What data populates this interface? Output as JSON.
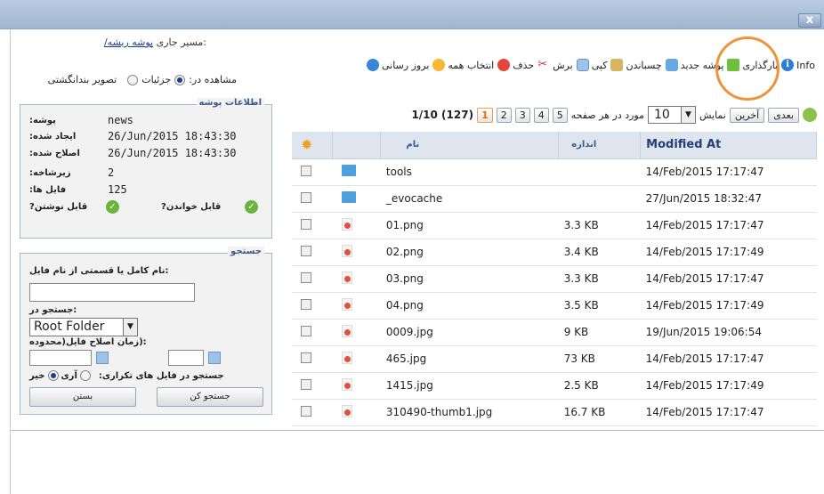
{
  "window": {
    "close_label": "x"
  },
  "header": {
    "path_root": "پوشه ریشه/",
    "path_label": ":مسیر جاری",
    "view_label": "مشاهده در:",
    "view_details": "جزئیات",
    "view_thumbs": "تصویر بندانگشتی"
  },
  "toolbar": {
    "items": [
      {
        "label": "Info",
        "icon": "info-icon"
      },
      {
        "label": "بارگذاری",
        "icon": "upload-icon"
      },
      {
        "label": "پوشه جدید",
        "icon": "new-folder-icon"
      },
      {
        "label": "چسباندن",
        "icon": "paste-icon"
      },
      {
        "label": "کپی",
        "icon": "copy-icon"
      },
      {
        "label": "برش",
        "icon": "cut-icon"
      },
      {
        "label": "حذف",
        "icon": "delete-icon"
      },
      {
        "label": "انتخاب همه",
        "icon": "select-all-icon"
      },
      {
        "label": "بروز رسانی",
        "icon": "refresh-icon"
      }
    ]
  },
  "info_panel": {
    "legend": "اطلاعات پوشه",
    "rows": [
      {
        "key": ":پوشه",
        "value": "news"
      },
      {
        "key": ":ایجاد شده",
        "value": "26/Jun/2015 18:43:30"
      },
      {
        "key": ":اصلاح شده",
        "value": "26/Jun/2015 18:43:30"
      },
      {
        "key": ":زیرشاخه",
        "value": "2"
      },
      {
        "key": ":فایل ها",
        "value": "125"
      }
    ],
    "writable_label": "?قابل نوشتن",
    "readable_label": "?قابل خواندن"
  },
  "search_panel": {
    "legend": "جستجو",
    "name_label": ":نام کامل یا قسمتی از نام فایل",
    "name_value": "",
    "in_label": ":جستجو در",
    "in_value": "Root Folder",
    "date_label": ":(زمان اصلاح فایل(محدوده",
    "date_from": "",
    "date_to": "",
    "dup_label": "جستجو در فایل های تکراری:",
    "dup_yes": "آری",
    "dup_no": "خیر",
    "search_button": "جستجو کن",
    "close_button": "بستن"
  },
  "pager": {
    "next": "بعدی",
    "last": "آخرین",
    "show": "نمایش",
    "per_page": "10",
    "per_page_label": "مورد در هر صفحه",
    "pages": [
      "5",
      "4",
      "3",
      "2",
      "1"
    ],
    "current_page": "1",
    "summary": "1/10 (127)"
  },
  "table": {
    "headers": {
      "name": "نام",
      "size": "اندازه",
      "modified": "Modified At"
    },
    "rows": [
      {
        "icon": "folder-icon",
        "name": "tools",
        "size": "",
        "modified": "14/Feb/2015 17:17:47"
      },
      {
        "icon": "folder-icon",
        "name": "_evocache",
        "size": "",
        "modified": "27/Jun/2015 18:32:47"
      },
      {
        "icon": "image-icon",
        "name": "01.png",
        "size": "3.3 KB",
        "modified": "14/Feb/2015 17:17:47"
      },
      {
        "icon": "image-icon",
        "name": "02.png",
        "size": "3.4 KB",
        "modified": "14/Feb/2015 17:17:49"
      },
      {
        "icon": "image-icon",
        "name": "03.png",
        "size": "3.3 KB",
        "modified": "14/Feb/2015 17:17:47"
      },
      {
        "icon": "image-icon",
        "name": "04.png",
        "size": "3.5 KB",
        "modified": "14/Feb/2015 17:17:49"
      },
      {
        "icon": "image-icon",
        "name": "0009.jpg",
        "size": "9 KB",
        "modified": "19/Jun/2015 19:06:54"
      },
      {
        "icon": "image-icon",
        "name": "465.jpg",
        "size": "73 KB",
        "modified": "14/Feb/2015 17:17:47"
      },
      {
        "icon": "image-icon",
        "name": "1415.jpg",
        "size": "2.5 KB",
        "modified": "14/Feb/2015 17:17:49"
      },
      {
        "icon": "image-icon",
        "name": "310490-thumb1.jpg",
        "size": "16.7 KB",
        "modified": "14/Feb/2015 17:17:47"
      }
    ]
  },
  "colors": {
    "highlight": "#f0943a",
    "accent": "#223e77"
  }
}
